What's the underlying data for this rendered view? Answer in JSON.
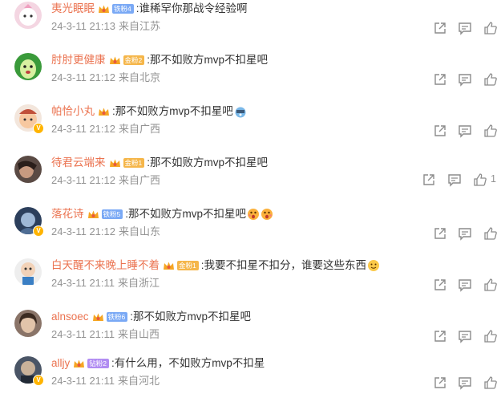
{
  "comments": [
    {
      "username": "夷光眠眠",
      "fan_badge": "铁粉4",
      "text": ":谁稀罕你那战令经验啊",
      "time": "24-3-11 21:13",
      "location": "来自江苏",
      "likes": ""
    },
    {
      "username": "肘肘更健康",
      "fan_badge": "金粉2",
      "text": ":那不如败方mvp不扣星吧",
      "time": "24-3-11 21:12",
      "location": "来自北京",
      "likes": ""
    },
    {
      "username": "帕恰小丸",
      "fan_badge": "",
      "text": ":那不如败方mvp不扣星吧",
      "time": "24-3-11 21:12",
      "location": "来自广西",
      "likes": ""
    },
    {
      "username": "待君云端来",
      "fan_badge": "金粉1",
      "text": ":那不如败方mvp不扣星吧",
      "time": "24-3-11 21:12",
      "location": "来自广西",
      "likes": "1"
    },
    {
      "username": "落花诗",
      "fan_badge": "铁粉5",
      "text": ":那不如败方mvp不扣星吧",
      "time": "24-3-11 21:12",
      "location": "来自山东",
      "likes": ""
    },
    {
      "username": "白天醒不来晚上睡不着",
      "fan_badge": "金粉1",
      "text": ":我要不扣星不扣分，谁要这些东西",
      "time": "24-3-11 21:11",
      "location": "来自浙江",
      "likes": ""
    },
    {
      "username": "alnsoec",
      "fan_badge": "铁粉6",
      "text": ":那不如败方mvp不扣星吧",
      "time": "24-3-11 21:11",
      "location": "来自山西",
      "likes": ""
    },
    {
      "username": "alljy",
      "fan_badge": "钻粉2",
      "text": ":有什么用，不如败方mvp不扣星",
      "time": "24-3-11 21:11",
      "location": "来自河北",
      "likes": ""
    }
  ],
  "icons": {
    "forward": "share-icon",
    "comment": "comment-icon",
    "like": "thumbs-up-icon",
    "crown": "crown-icon"
  },
  "colors": {
    "username": "#eb7350",
    "meta": "#939393",
    "text": "#333333"
  }
}
